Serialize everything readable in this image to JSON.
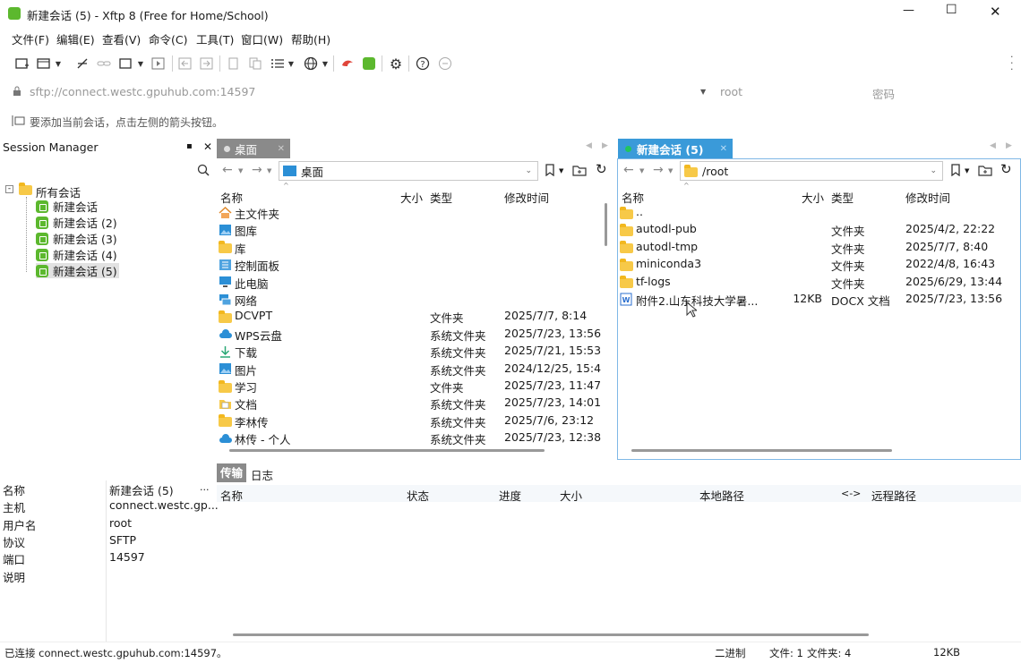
{
  "window": {
    "title": "新建会话 (5) - Xftp 8 (Free for Home/School)",
    "controls": {
      "minimize": "—",
      "maximize": "☐",
      "close": "✕"
    }
  },
  "menu": [
    "文件(F)",
    "编辑(E)",
    "查看(V)",
    "命令(C)",
    "工具(T)",
    "窗口(W)",
    "帮助(H)"
  ],
  "address_bar": {
    "url_placeholder": "sftp://connect.westc.gpuhub.com:14597",
    "user_placeholder": "root",
    "password_placeholder": "密码"
  },
  "hint": "要添加当前会话，点击左侧的箭头按钮。",
  "session_manager": {
    "title": "Session Manager",
    "pin": "📌",
    "close": "✕",
    "root_label": "所有会话",
    "items": [
      "新建会话",
      "新建会话 (2)",
      "新建会话 (3)",
      "新建会话 (4)",
      "新建会话 (5)"
    ],
    "selected_index": 4
  },
  "properties": {
    "rows": [
      {
        "key": "名称",
        "value": "新建会话 (5)"
      },
      {
        "key": "主机",
        "value": "connect.westc.gp..."
      },
      {
        "key": "用户名",
        "value": "root"
      },
      {
        "key": "协议",
        "value": "SFTP"
      },
      {
        "key": "端口",
        "value": "14597"
      },
      {
        "key": "说明",
        "value": ""
      }
    ],
    "more_button": "..."
  },
  "local_pane": {
    "tab_label": "桌面",
    "path": "桌面",
    "columns": [
      "名称",
      "大小",
      "类型",
      "修改时间"
    ],
    "rows": [
      {
        "icon": "home-icon",
        "name": "主文件夹",
        "size": "",
        "type": "",
        "modified": ""
      },
      {
        "icon": "gallery-icon",
        "name": "图库",
        "size": "",
        "type": "",
        "modified": ""
      },
      {
        "icon": "folder-icon",
        "name": "库",
        "size": "",
        "type": "",
        "modified": ""
      },
      {
        "icon": "control-panel-icon",
        "name": "控制面板",
        "size": "",
        "type": "",
        "modified": ""
      },
      {
        "icon": "computer-icon",
        "name": "此电脑",
        "size": "",
        "type": "",
        "modified": ""
      },
      {
        "icon": "network-icon",
        "name": "网络",
        "size": "",
        "type": "",
        "modified": ""
      },
      {
        "icon": "folder-icon",
        "name": "DCVPT",
        "size": "",
        "type": "文件夹",
        "modified": "2025/7/7, 8:14"
      },
      {
        "icon": "cloud-icon",
        "name": "WPS云盘",
        "size": "",
        "type": "系统文件夹",
        "modified": "2025/7/23, 13:56"
      },
      {
        "icon": "download-icon",
        "name": "下载",
        "size": "",
        "type": "系统文件夹",
        "modified": "2025/7/21, 15:53"
      },
      {
        "icon": "picture-icon",
        "name": "图片",
        "size": "",
        "type": "系统文件夹",
        "modified": "2024/12/25, 15:4"
      },
      {
        "icon": "folder-icon",
        "name": "学习",
        "size": "",
        "type": "文件夹",
        "modified": "2025/7/23, 11:47"
      },
      {
        "icon": "document-icon",
        "name": "文档",
        "size": "",
        "type": "系统文件夹",
        "modified": "2025/7/23, 14:01"
      },
      {
        "icon": "folder-icon",
        "name": "李林传",
        "size": "",
        "type": "系统文件夹",
        "modified": "2025/7/6, 23:12"
      },
      {
        "icon": "cloud-icon",
        "name": "林传 - 个人",
        "size": "",
        "type": "系统文件夹",
        "modified": "2025/7/23, 12:38"
      }
    ]
  },
  "remote_pane": {
    "tab_label": "新建会话 (5)",
    "path": "/root",
    "columns": [
      "名称",
      "大小",
      "类型",
      "修改时间"
    ],
    "rows": [
      {
        "icon": "folder-icon",
        "name": "..",
        "size": "",
        "type": "",
        "modified": ""
      },
      {
        "icon": "folder-link-icon",
        "name": "autodl-pub",
        "size": "",
        "type": "文件夹",
        "modified": "2025/4/2, 22:22"
      },
      {
        "icon": "folder-icon",
        "name": "autodl-tmp",
        "size": "",
        "type": "文件夹",
        "modified": "2025/7/7, 8:40"
      },
      {
        "icon": "folder-icon",
        "name": "miniconda3",
        "size": "",
        "type": "文件夹",
        "modified": "2022/4/8, 16:43"
      },
      {
        "icon": "folder-icon",
        "name": "tf-logs",
        "size": "",
        "type": "文件夹",
        "modified": "2025/6/29, 13:44"
      },
      {
        "icon": "word-doc-icon",
        "name": "附件2.山东科技大学暑...",
        "size": "12KB",
        "type": "DOCX 文档",
        "modified": "2025/7/23, 13:56"
      }
    ]
  },
  "transfer": {
    "tabs": [
      "传输",
      "日志"
    ],
    "active_tab": 0,
    "columns": [
      "名称",
      "状态",
      "进度",
      "大小",
      "本地路径",
      "<->",
      "远程路径"
    ]
  },
  "status_bar": {
    "connection": "已连接 connect.westc.gpuhub.com:14597。",
    "mode": "二进制",
    "files": "文件: 1",
    "folders": "文件夹: 4",
    "size": "12KB"
  },
  "colors": {
    "accent": "#3a9ad9",
    "selected_bg": "#cce4f7",
    "session_green": "#5cb82e",
    "online_dot": "#22c55e"
  }
}
